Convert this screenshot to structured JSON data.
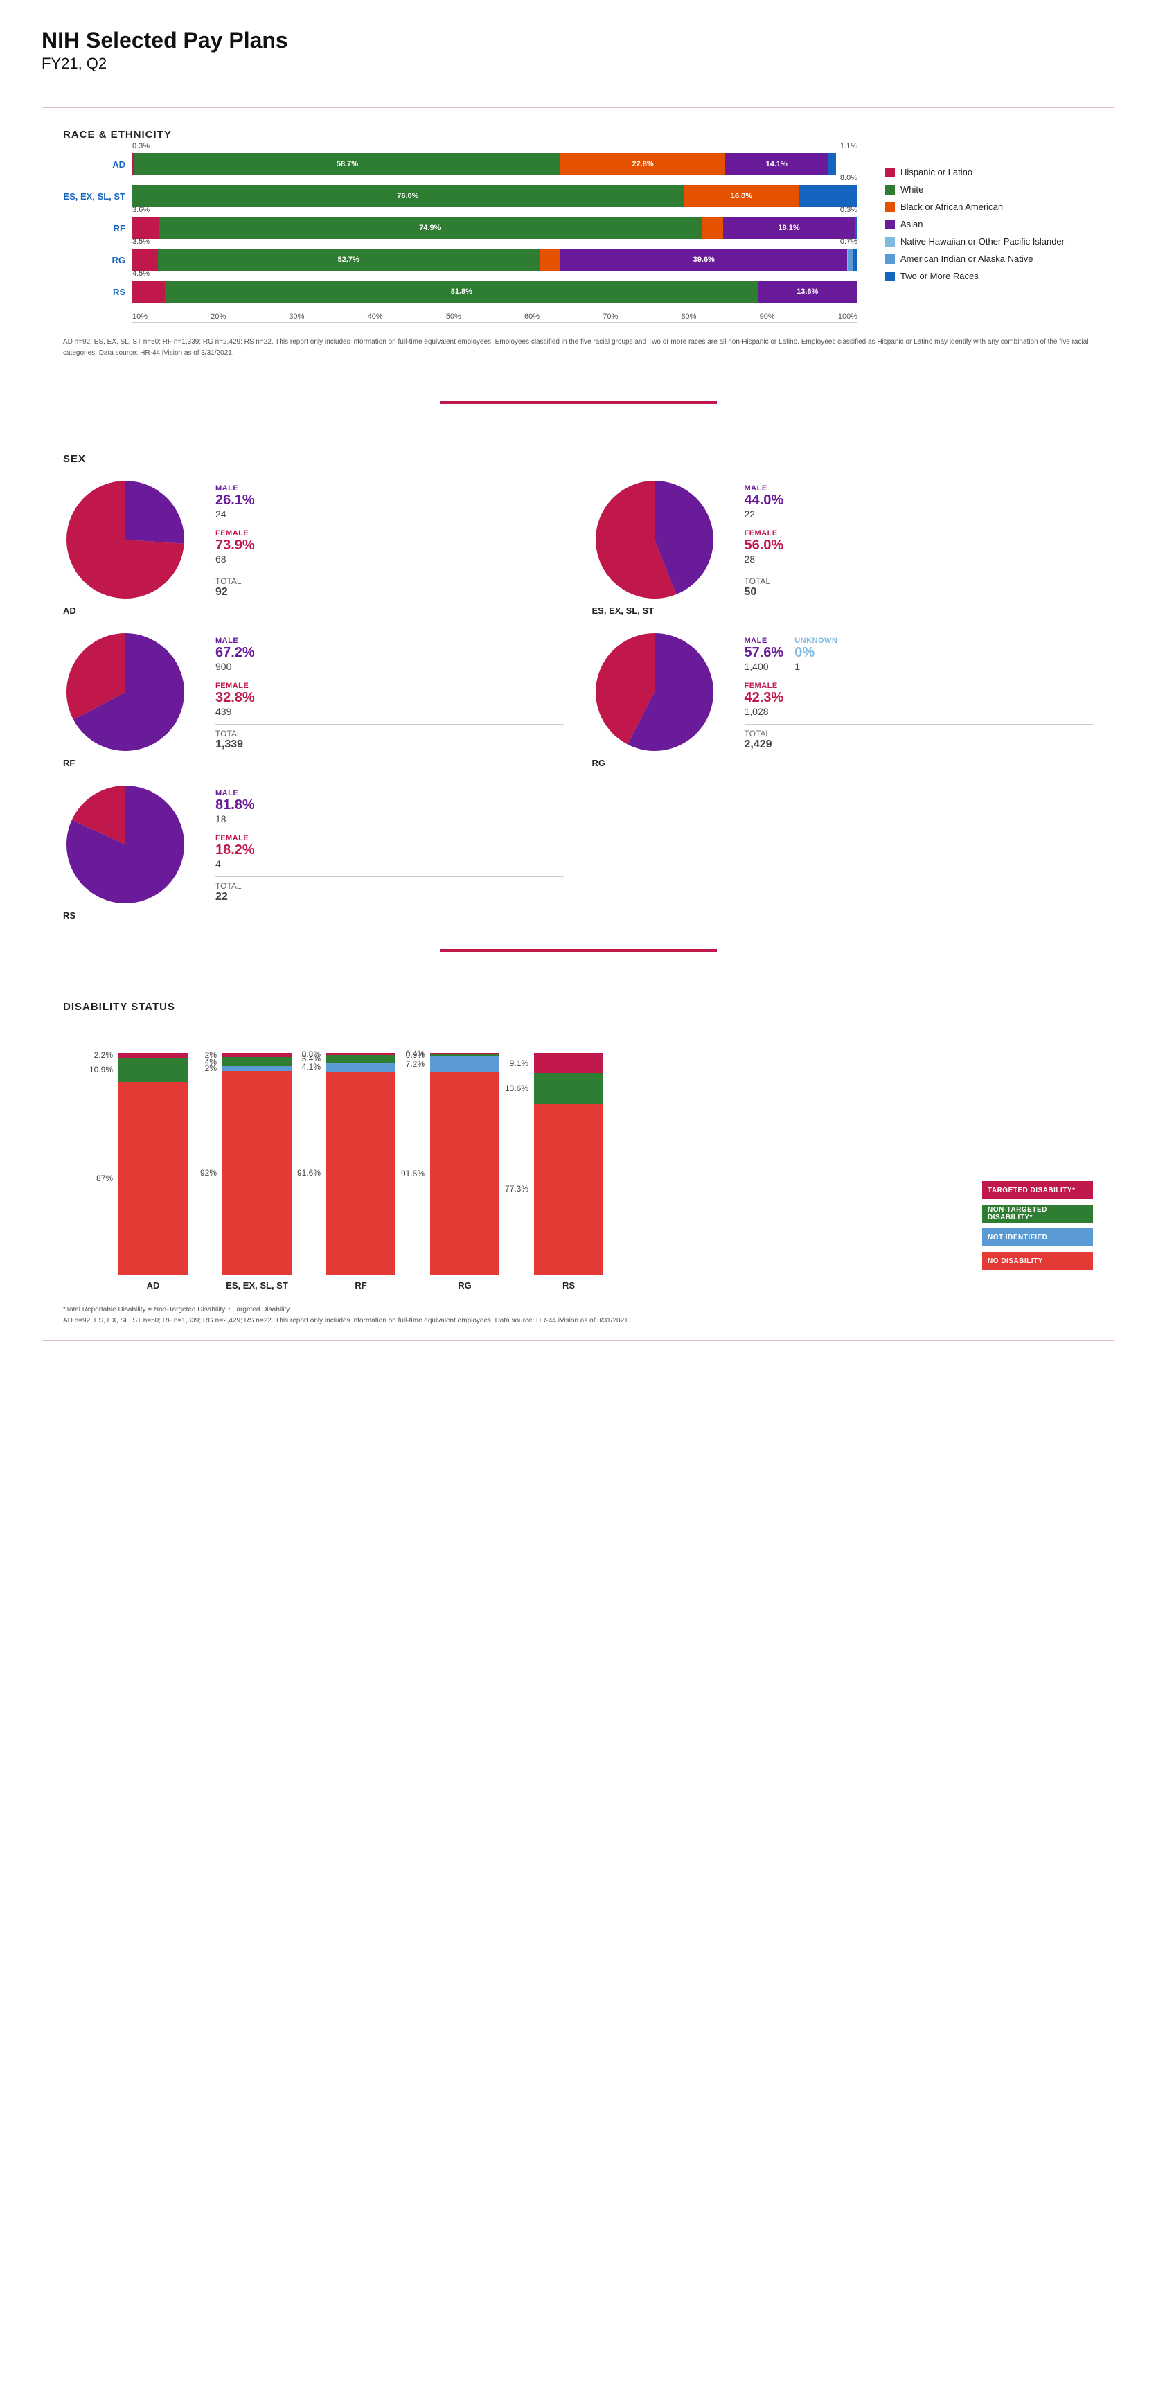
{
  "header": {
    "title": "NIH Selected Pay Plans",
    "subtitle": "FY21, Q2"
  },
  "race_section": {
    "title": "RACE & ETHNICITY",
    "bars": [
      {
        "label": "AD",
        "above_left": "0.3%",
        "above_right": "1.1%",
        "segments": [
          {
            "color": "#c0184a",
            "pct": 0.3,
            "label": ""
          },
          {
            "color": "#2e7d32",
            "pct": 58.7,
            "label": "58.7%"
          },
          {
            "color": "#e65100",
            "pct": 22.8,
            "label": "22.8%"
          },
          {
            "color": "#6a1b9a",
            "pct": 14.1,
            "label": "14.1%"
          },
          {
            "color": "#7fbbdf",
            "pct": 0.0,
            "label": ""
          },
          {
            "color": "#5b9bd5",
            "pct": 0.0,
            "label": ""
          },
          {
            "color": "#1565c0",
            "pct": 1.1,
            "label": ""
          }
        ]
      },
      {
        "label": "ES, EX, SL, ST",
        "above_left": "",
        "above_right": "8.0%",
        "segments": [
          {
            "color": "#c0184a",
            "pct": 0.0,
            "label": ""
          },
          {
            "color": "#2e7d32",
            "pct": 76.0,
            "label": "76.0%"
          },
          {
            "color": "#e65100",
            "pct": 16.0,
            "label": "16.0%"
          },
          {
            "color": "#6a1b9a",
            "pct": 0.0,
            "label": ""
          },
          {
            "color": "#7fbbdf",
            "pct": 0.0,
            "label": ""
          },
          {
            "color": "#5b9bd5",
            "pct": 0.0,
            "label": ""
          },
          {
            "color": "#1565c0",
            "pct": 8.0,
            "label": ""
          }
        ]
      },
      {
        "label": "RF",
        "above_left": "3.6%",
        "above_right": "0.3%",
        "segments": [
          {
            "color": "#c0184a",
            "pct": 3.6,
            "label": ""
          },
          {
            "color": "#2e7d32",
            "pct": 74.9,
            "label": "74.9%"
          },
          {
            "color": "#e65100",
            "pct": 3.0,
            "label": "3.0%"
          },
          {
            "color": "#6a1b9a",
            "pct": 18.1,
            "label": "18.1%"
          },
          {
            "color": "#7fbbdf",
            "pct": 0.1,
            "label": ""
          },
          {
            "color": "#5b9bd5",
            "pct": 0.0,
            "label": ""
          },
          {
            "color": "#1565c0",
            "pct": 0.3,
            "label": ""
          }
        ]
      },
      {
        "label": "RG",
        "above_left": "3.5%",
        "above_right": "0.7%",
        "segments": [
          {
            "color": "#c0184a",
            "pct": 3.5,
            "label": ""
          },
          {
            "color": "#2e7d32",
            "pct": 52.7,
            "label": "52.7%"
          },
          {
            "color": "#e65100",
            "pct": 2.9,
            "label": "2.9%"
          },
          {
            "color": "#6a1b9a",
            "pct": 39.6,
            "label": "39.6%"
          },
          {
            "color": "#7fbbdf",
            "pct": 0.2,
            "label": ""
          },
          {
            "color": "#5b9bd5",
            "pct": 0.5,
            "label": "0.5%"
          },
          {
            "color": "#1565c0",
            "pct": 0.7,
            "label": "0.7%"
          }
        ]
      },
      {
        "label": "RS",
        "above_left": "4.5%",
        "above_right": "",
        "segments": [
          {
            "color": "#c0184a",
            "pct": 4.5,
            "label": ""
          },
          {
            "color": "#2e7d32",
            "pct": 81.8,
            "label": "81.8%"
          },
          {
            "color": "#e65100",
            "pct": 0.0,
            "label": ""
          },
          {
            "color": "#6a1b9a",
            "pct": 13.6,
            "label": "13.6%"
          },
          {
            "color": "#7fbbdf",
            "pct": 0.0,
            "label": ""
          },
          {
            "color": "#5b9bd5",
            "pct": 0.0,
            "label": ""
          },
          {
            "color": "#1565c0",
            "pct": 0.0,
            "label": ""
          }
        ]
      }
    ],
    "x_axis": [
      "10%",
      "20%",
      "30%",
      "40%",
      "50%",
      "60%",
      "70%",
      "80%",
      "90%",
      "100%"
    ],
    "legend": [
      {
        "color": "#c0184a",
        "label": "Hispanic or Latino"
      },
      {
        "color": "#2e7d32",
        "label": "White"
      },
      {
        "color": "#e65100",
        "label": "Black or African American"
      },
      {
        "color": "#6a1b9a",
        "label": "Asian"
      },
      {
        "color": "#7fbbdf",
        "label": "Native Hawaiian or Other Pacific Islander"
      },
      {
        "color": "#5b9bd5",
        "label": "American Indian or Alaska Native"
      },
      {
        "color": "#1565c0",
        "label": "Two or More Races"
      }
    ],
    "footnote": "AD n=92; ES, EX, SL, ST n=50; RF n=1,339; RG n=2,429; RS n=22. This report only includes information on full-time equivalent employees. Employees classified in the five racial groups and Two or more races are all non-Hispanic or Latino. Employees classified as Hispanic or Latino may identify with any combination of the five racial categories. Data source: HR-44 iVision as of 3/31/2021."
  },
  "sex_section": {
    "title": "SEX",
    "groups": [
      {
        "label": "AD",
        "male_pct": "26.1%",
        "male_count": "24",
        "female_pct": "73.9%",
        "female_count": "68",
        "total": "92",
        "male_angle": 26.1,
        "unknown_pct": null,
        "unknown_count": null
      },
      {
        "label": "ES, EX, SL, ST",
        "male_pct": "44.0%",
        "male_count": "22",
        "female_pct": "56.0%",
        "female_count": "28",
        "total": "50",
        "male_angle": 44.0,
        "unknown_pct": null,
        "unknown_count": null
      },
      {
        "label": "RF",
        "male_pct": "67.2%",
        "male_count": "900",
        "female_pct": "32.8%",
        "female_count": "439",
        "total": "1,339",
        "male_angle": 67.2,
        "unknown_pct": null,
        "unknown_count": null
      },
      {
        "label": "RG",
        "male_pct": "57.6%",
        "male_count": "1,400",
        "female_pct": "42.3%",
        "female_count": "1,028",
        "total": "2,429",
        "male_angle": 57.6,
        "unknown_pct": "0%",
        "unknown_count": "1"
      },
      {
        "label": "RS",
        "male_pct": "81.8%",
        "male_count": "18",
        "female_pct": "18.2%",
        "female_count": "4",
        "total": "22",
        "male_angle": 81.8,
        "unknown_pct": null,
        "unknown_count": null
      }
    ],
    "male_color": "#1565c0",
    "female_color": "#c0184a",
    "unknown_color": "#7fbbdf",
    "male_label": "MALE",
    "female_label": "FEMALE",
    "unknown_label": "UNKNOWN",
    "total_label": "TOTAL"
  },
  "disability_section": {
    "title": "DISABILITY STATUS",
    "groups": [
      {
        "label": "AD",
        "targeted": 2.2,
        "non_targeted": 10.9,
        "not_identified": 0,
        "no_disability": 87.0
      },
      {
        "label": "ES, EX, SL, ST",
        "targeted": 2.0,
        "non_targeted": 4.0,
        "not_identified": 2.0,
        "no_disability": 92.0
      },
      {
        "label": "RF",
        "targeted": 0.8,
        "non_targeted": 3.4,
        "not_identified": 4.1,
        "no_disability": 91.6
      },
      {
        "label": "RG",
        "targeted": 0.4,
        "non_targeted": 0.9,
        "not_identified": 7.2,
        "no_disability": 91.5
      },
      {
        "label": "RS",
        "targeted": 9.1,
        "non_targeted": 13.6,
        "not_identified": 0,
        "no_disability": 77.3
      }
    ],
    "legend": [
      {
        "color": "#c0184a",
        "label": "TARGETED DISABILITY*"
      },
      {
        "color": "#2e7d32",
        "label": "NON-TARGETED DISABILITY*"
      },
      {
        "color": "#5b9bd5",
        "label": "NOT IDENTIFIED"
      },
      {
        "color": "#e53935",
        "label": "NO DISABILITY"
      }
    ],
    "targeted_color": "#c0184a",
    "non_targeted_color": "#2e7d32",
    "not_identified_color": "#5b9bd5",
    "no_disability_color": "#e53935",
    "footnote": "*Total Reportable Disability = Non-Targeted Disability + Targeted Disability\nAD n=92; ES, EX, SL, ST n=50; RF n=1,339; RG n=2,429; RS n=22. This report only includes information on full-time equivalent employees. Data source: HR-44 iVision as of 3/31/2021."
  }
}
